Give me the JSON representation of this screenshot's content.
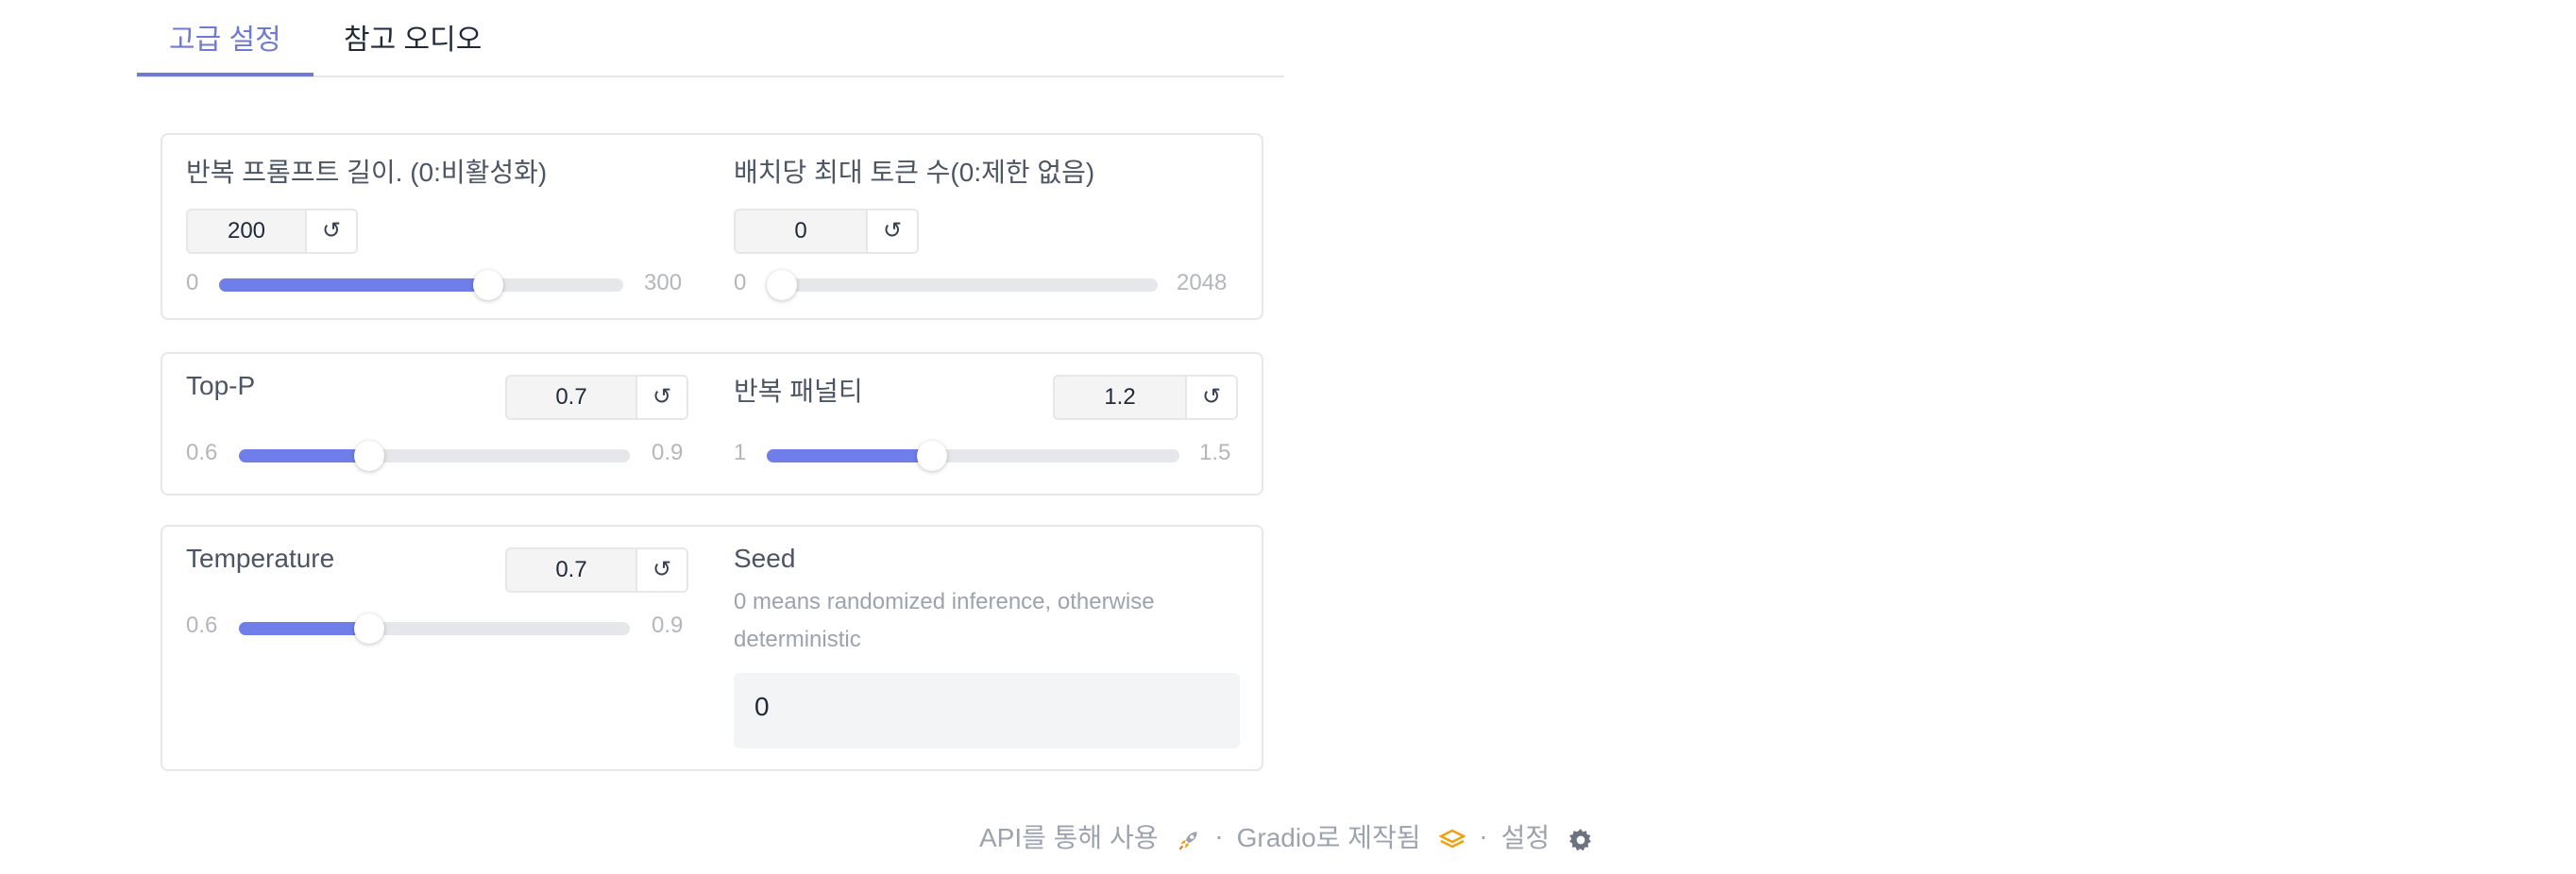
{
  "tabs": [
    {
      "label": "고급 설정",
      "active": true
    },
    {
      "label": "참고 오디오",
      "active": false
    }
  ],
  "sliders": {
    "repeat_prompt": {
      "label": "반복 프롬프트 길이. (0:비활성화)",
      "value": "200",
      "min": "0",
      "max": "300",
      "fraction": 0.667
    },
    "max_tokens": {
      "label": "배치당 최대 토큰 수(0:제한 없음)",
      "value": "0",
      "min": "0",
      "max": "2048",
      "fraction": 0.0
    },
    "top_p": {
      "label": "Top-P",
      "value": "0.7",
      "min": "0.6",
      "max": "0.9",
      "fraction": 0.333
    },
    "repetition_penalty": {
      "label": "반복 패널티",
      "value": "1.2",
      "min": "1",
      "max": "1.5",
      "fraction": 0.4
    },
    "temperature": {
      "label": "Temperature",
      "value": "0.7",
      "min": "0.6",
      "max": "0.9",
      "fraction": 0.333
    }
  },
  "reset_icon": "↺",
  "seed": {
    "label": "Seed",
    "info": "0 means randomized inference, otherwise deterministic",
    "value": "0"
  },
  "footer": {
    "api": "API를 통해 사용",
    "gradio": "Gradio로 제작됨",
    "settings": "설정",
    "separator": "·",
    "icons": [
      "rocket-icon",
      "gradio-logo-icon",
      "gear-icon"
    ]
  },
  "colors": {
    "accent": "#6f7ad3",
    "slider_fill": "#6f7ee8",
    "gradio_orange": "#f59e0b"
  }
}
